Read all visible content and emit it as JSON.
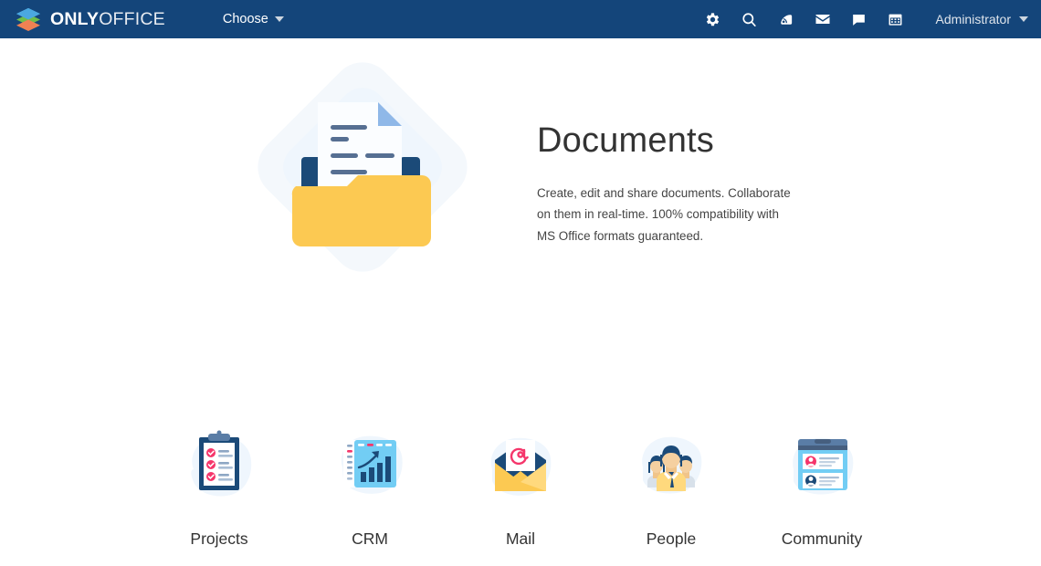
{
  "header": {
    "logo_icon": "onlyoffice-layers-logo",
    "brand_only": "ONLY",
    "brand_office": "OFFICE",
    "choose_label": "Choose",
    "choose_caret_icon": "caret-down-icon",
    "icons": [
      {
        "name": "gear-icon",
        "title": "Settings"
      },
      {
        "name": "search-icon",
        "title": "Search"
      },
      {
        "name": "feed-icon",
        "title": "Feed"
      },
      {
        "name": "mail-icon",
        "title": "Mail"
      },
      {
        "name": "chat-icon",
        "title": "Talk"
      },
      {
        "name": "calendar-icon",
        "title": "Calendar"
      }
    ],
    "user_label": "Administrator",
    "user_caret_icon": "caret-down-icon",
    "background_color": "#14457a"
  },
  "hero": {
    "illustration": "documents-folder-illustration",
    "title": "Documents",
    "description": "Create, edit and share documents. Collaborate on them in real-time. 100% compatibility with MS Office formats guaranteed."
  },
  "apps": [
    {
      "label": "Projects",
      "icon": "clipboard-checklist-icon"
    },
    {
      "label": "CRM",
      "icon": "dashboard-chart-icon"
    },
    {
      "label": "Mail",
      "icon": "open-envelope-at-icon"
    },
    {
      "label": "People",
      "icon": "people-group-icon"
    },
    {
      "label": "Community",
      "icon": "community-posts-icon"
    }
  ],
  "colors": {
    "header_blue": "#14457a",
    "navy": "#1b4a78",
    "amber": "#fcc952",
    "pink": "#f5366b",
    "light_blue": "#72cdf4",
    "pale_blue": "#f4f8fc",
    "page_background": "#ffffff",
    "text_dark": "#333333"
  }
}
